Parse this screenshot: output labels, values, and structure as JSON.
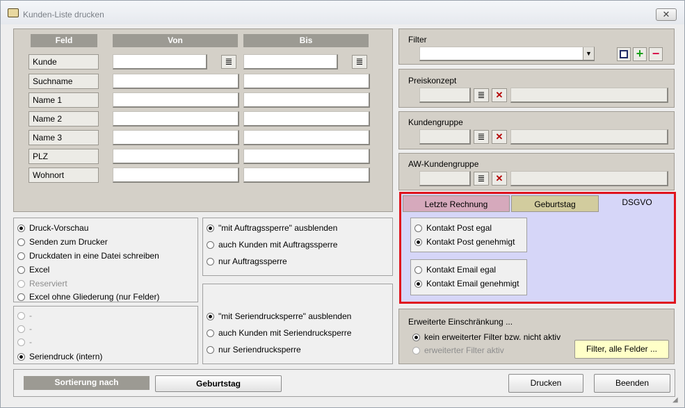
{
  "window": {
    "title": "Kunden-Liste drucken",
    "close": "✕"
  },
  "fields": {
    "header_feld": "Feld",
    "header_von": "Von",
    "header_bis": "Bis",
    "rows": [
      "Kunde",
      "Suchname",
      "Name 1",
      "Name 2",
      "Name 3",
      "PLZ",
      "Wohnort"
    ]
  },
  "output": {
    "items": [
      {
        "label": "Druck-Vorschau",
        "checked": true,
        "disabled": false
      },
      {
        "label": "Senden zum Drucker",
        "checked": false,
        "disabled": false
      },
      {
        "label": "Druckdaten in eine Datei schreiben",
        "checked": false,
        "disabled": false
      },
      {
        "label": "Excel",
        "checked": false,
        "disabled": false
      },
      {
        "label": "Reserviert",
        "checked": false,
        "disabled": true
      },
      {
        "label": "Excel ohne Gliederung (nur Felder)",
        "checked": false,
        "disabled": false
      }
    ]
  },
  "extra": {
    "items": [
      {
        "label": "-",
        "checked": false,
        "disabled": true
      },
      {
        "label": "-",
        "checked": false,
        "disabled": true
      },
      {
        "label": "-",
        "checked": false,
        "disabled": true
      },
      {
        "label": "Seriendruck (intern)",
        "checked": true,
        "disabled": false
      }
    ]
  },
  "auftrag": {
    "items": [
      {
        "label": "\"mit Auftragssperre\" ausblenden",
        "checked": true
      },
      {
        "label": "auch Kunden mit Auftragssperre",
        "checked": false
      },
      {
        "label": "nur Auftragssperre",
        "checked": false
      }
    ]
  },
  "serien": {
    "items": [
      {
        "label": "\"mit Seriendrucksperre\" ausblenden",
        "checked": true
      },
      {
        "label": "auch Kunden mit Seriendrucksperre",
        "checked": false
      },
      {
        "label": "nur Seriendrucksperre",
        "checked": false
      }
    ]
  },
  "filter": {
    "title": "Filter",
    "save_icon": "save-icon",
    "add": "+",
    "remove": "−"
  },
  "preiskonzept": {
    "title": "Preiskonzept"
  },
  "kundengruppe": {
    "title": "Kundengruppe"
  },
  "aw_kundengruppe": {
    "title": "AW-Kundengruppe"
  },
  "tabs": {
    "items": [
      "Letzte Rechnung",
      "Geburtstag",
      "DSGVO"
    ],
    "active": "DSGVO",
    "post": [
      {
        "label": "Kontakt Post egal",
        "checked": false
      },
      {
        "label": "Kontakt Post genehmigt",
        "checked": true
      }
    ],
    "email": [
      {
        "label": "Kontakt Email egal",
        "checked": false
      },
      {
        "label": "Kontakt Email genehmigt",
        "checked": true
      }
    ]
  },
  "erweitert": {
    "title": "Erweiterte Einschränkung ...",
    "items": [
      {
        "label": "kein erweiterter Filter bzw. nicht aktiv",
        "checked": true,
        "disabled": false
      },
      {
        "label": "erweiterter Filter aktiv",
        "checked": false,
        "disabled": true
      }
    ],
    "button": "Filter, alle Felder ..."
  },
  "bottom": {
    "sort_label": "Sortierung nach",
    "sort_value": "Geburtstag",
    "print_button": "Drucken",
    "exit_button": "Beenden"
  },
  "colors": {
    "highlight": "#e0141e",
    "tab_active_bg": "#d6d6f8",
    "tab1_bg": "#d6a9bc",
    "tab2_bg": "#d2cc9e",
    "button_yellow": "#ffffc8"
  }
}
